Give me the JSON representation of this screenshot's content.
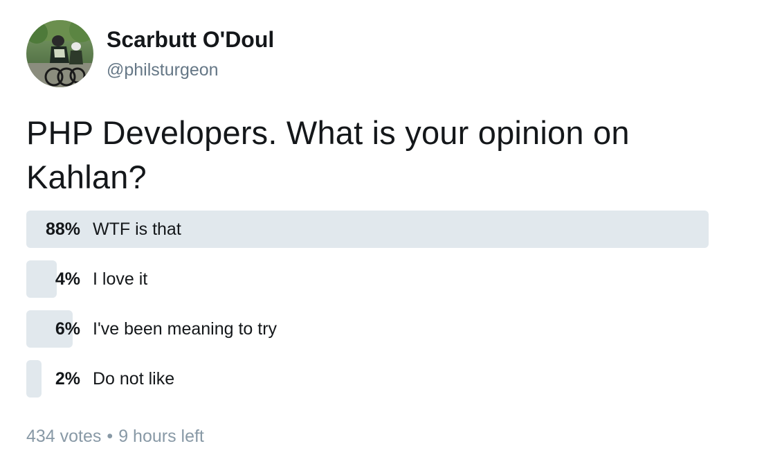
{
  "user": {
    "display_name": "Scarbutt O'Doul",
    "screen_name": "@philsturgeon",
    "avatar_icon": "cyclist-photo-avatar"
  },
  "tweet": {
    "text": "PHP Developers. What is your opinion on Kahlan?"
  },
  "poll": {
    "choices": [
      {
        "percent_label": "88%",
        "percent": 88,
        "label": "WTF is that"
      },
      {
        "percent_label": "4%",
        "percent": 4,
        "label": "I love it"
      },
      {
        "percent_label": "6%",
        "percent": 6,
        "label": "I've been meaning to try"
      },
      {
        "percent_label": "2%",
        "percent": 2,
        "label": "Do not like"
      }
    ],
    "votes": "434 votes",
    "separator": "•",
    "time_left": "9 hours left"
  },
  "colors": {
    "bar": "#e1e8ed",
    "text": "#14171a",
    "secondary": "#657786",
    "footer": "#8899a6"
  }
}
